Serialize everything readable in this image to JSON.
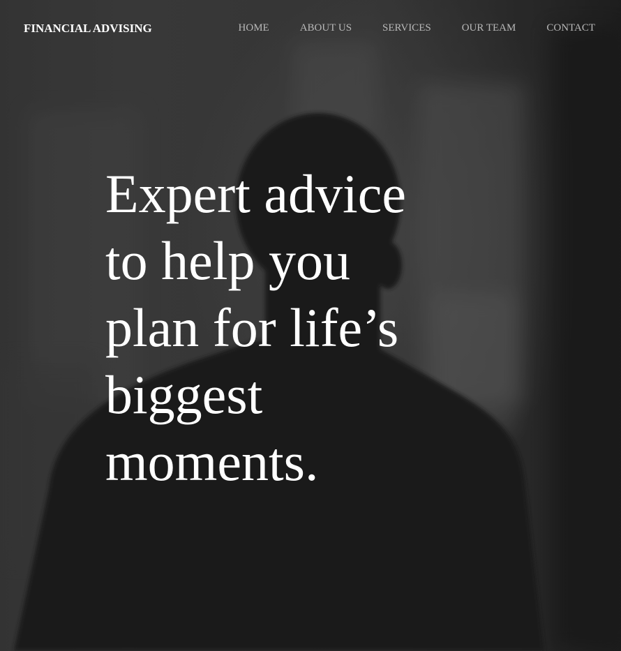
{
  "brand": {
    "name": "FINANCIAL ADVISING"
  },
  "nav": {
    "items": [
      {
        "label": "HOME"
      },
      {
        "label": "ABOUT US"
      },
      {
        "label": "SERVICES"
      },
      {
        "label": "OUR TEAM"
      },
      {
        "label": "CONTACT"
      }
    ]
  },
  "hero": {
    "headline": "Expert advice to help you plan for life’s biggest moments."
  },
  "colors": {
    "text_primary": "#ffffff",
    "nav_text": "#b9b9b9",
    "background": "#2b2b2b"
  }
}
